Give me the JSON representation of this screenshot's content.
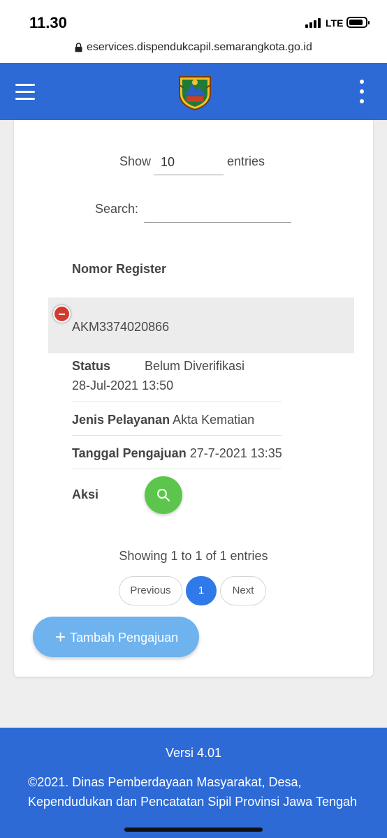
{
  "status_bar": {
    "time": "11.30",
    "network": "LTE"
  },
  "browser": {
    "url": "eservices.dispendukcapil.semarangkota.go.id"
  },
  "table_controls": {
    "show_label": "Show",
    "entries_value": "10",
    "entries_label": "entries",
    "search_label": "Search:",
    "search_value": ""
  },
  "table": {
    "column_header": "Nomor Register",
    "row": {
      "nomor_register": "AKM3374020866",
      "status_label": "Status",
      "status_value": "Belum Diverifikasi",
      "status_date": "28-Jul-2021 13:50",
      "jenis_label": "Jenis Pelayanan",
      "jenis_value": "Akta Kematian",
      "tanggal_label": "Tanggal Pengajuan",
      "tanggal_value": "27-7-2021 13:35",
      "aksi_label": "Aksi"
    }
  },
  "pagination": {
    "info": "Showing 1 to 1 of 1 entries",
    "previous": "Previous",
    "current_page": "1",
    "next": "Next"
  },
  "add_button": {
    "plus": "+",
    "label": "Tambah Pengajuan"
  },
  "footer": {
    "version": "Versi 4.01",
    "copyright_line1": "©2021. Dinas Pemberdayaan Masyarakat, Desa,",
    "copyright_line2": "Kependudukan dan Pencatatan Sipil Provinsi Jawa Tengah"
  },
  "colors": {
    "primary": "#2d6ad6",
    "collapse": "#d23a2e",
    "view": "#5cc64c",
    "page_active": "#2f7ae8",
    "add": "#6eb2ee"
  },
  "icons": [
    "lock-icon",
    "hamburger-icon",
    "logo",
    "kebab-icon",
    "minus-icon",
    "search-icon",
    "plus-icon"
  ]
}
